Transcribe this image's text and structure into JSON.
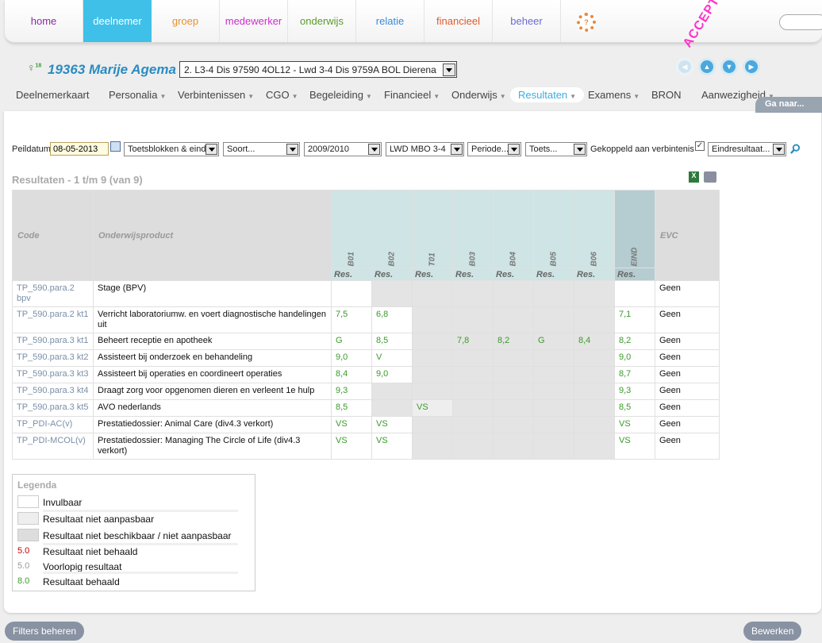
{
  "topnav": {
    "tabs": [
      {
        "label": "home",
        "color": "#8a2aa6"
      },
      {
        "label": "deelnemer",
        "color": "#ffffff"
      },
      {
        "label": "groep",
        "color": "#e8902a"
      },
      {
        "label": "medewerker",
        "color": "#cc2ecc"
      },
      {
        "label": "onderwijs",
        "color": "#5a9a2a"
      },
      {
        "label": "relatie",
        "color": "#3a8ad8"
      },
      {
        "label": "financieel",
        "color": "#e05a2a"
      },
      {
        "label": "beheer",
        "color": "#6a6ad8"
      }
    ],
    "active": "deelnemer",
    "stamp": "ACCEPT"
  },
  "student": {
    "name": "19363 Marije Agema",
    "age_badge": "18",
    "enrollment": "2. L3-4 Dis 97590 4OL12 - Lwd 3-4 Dis 9759A BOL Dierena"
  },
  "subnav": {
    "items": [
      {
        "label": "Deelnemerkaart",
        "caret": false
      },
      {
        "label": "Personalia",
        "caret": true
      },
      {
        "label": "Verbintenissen",
        "caret": true
      },
      {
        "label": "CGO",
        "caret": true
      },
      {
        "label": "Begeleiding",
        "caret": true
      },
      {
        "label": "Financieel",
        "caret": true
      },
      {
        "label": "Onderwijs",
        "caret": true
      },
      {
        "label": "Resultaten",
        "caret": true
      },
      {
        "label": "Examens",
        "caret": true
      },
      {
        "label": "BRON",
        "caret": false
      },
      {
        "label": "Aanwezigheid",
        "caret": true
      }
    ],
    "active": "Resultaten",
    "ga_naar": "Ga naar..."
  },
  "filters": {
    "peildatum_label": "Peildatum",
    "peildatum_value": "08-05-2013",
    "toetsblokken": "Toetsblokken & eind",
    "soort": "Soort...",
    "jaar": "2009/2010",
    "opleiding": "LWD MBO 3-4",
    "periode": "Periode...",
    "toets": "Toets...",
    "gekoppeld_label": "Gekoppeld aan verbintenis",
    "gekoppeld_checked": true,
    "eindresultaat": "Eindresultaat..."
  },
  "results": {
    "title": "Resultaten - 1 t/m 9 (van 9)",
    "headers": {
      "code": "Code",
      "product": "Onderwijsproduct",
      "columns": [
        "B01",
        "B02",
        "T01",
        "B03",
        "B04",
        "B05",
        "B06",
        "EIND"
      ],
      "sub": "Res.",
      "evc": "EVC"
    },
    "rows": [
      {
        "code": "TP_590.para.2 bpv",
        "product": "Stage (BPV)",
        "cells": [
          {
            "v": "",
            "s": "empty"
          },
          {
            "v": "",
            "s": "na"
          },
          {
            "v": "",
            "s": "na"
          },
          {
            "v": "",
            "s": "na"
          },
          {
            "v": "",
            "s": "na"
          },
          {
            "v": "",
            "s": "na"
          },
          {
            "v": "",
            "s": "na"
          },
          {
            "v": "",
            "s": "empty"
          }
        ],
        "evc": "Geen"
      },
      {
        "code": "TP_590.para.2 kt1",
        "product": "Verricht laboratoriumw. en voert diagnostische handelingen uit",
        "cells": [
          {
            "v": "7,5",
            "s": "empty"
          },
          {
            "v": "6,8",
            "s": "empty"
          },
          {
            "v": "",
            "s": "na"
          },
          {
            "v": "",
            "s": "na"
          },
          {
            "v": "",
            "s": "na"
          },
          {
            "v": "",
            "s": "na"
          },
          {
            "v": "",
            "s": "na"
          },
          {
            "v": "7,1",
            "s": "empty"
          }
        ],
        "evc": "Geen"
      },
      {
        "code": "TP_590.para.3 kt1",
        "product": "Beheert receptie en apotheek",
        "cells": [
          {
            "v": "G",
            "s": "empty"
          },
          {
            "v": "8,5",
            "s": "empty"
          },
          {
            "v": "",
            "s": "na"
          },
          {
            "v": "7,8",
            "s": "na"
          },
          {
            "v": "8,2",
            "s": "na"
          },
          {
            "v": "G",
            "s": "na"
          },
          {
            "v": "8,4",
            "s": "na"
          },
          {
            "v": "8,2",
            "s": "empty"
          }
        ],
        "evc": "Geen"
      },
      {
        "code": "TP_590.para.3 kt2",
        "product": "Assisteert bij onderzoek en behandeling",
        "cells": [
          {
            "v": "9,0",
            "s": "empty"
          },
          {
            "v": "V",
            "s": "empty"
          },
          {
            "v": "",
            "s": "na"
          },
          {
            "v": "",
            "s": "na"
          },
          {
            "v": "",
            "s": "na"
          },
          {
            "v": "",
            "s": "na"
          },
          {
            "v": "",
            "s": "na"
          },
          {
            "v": "9,0",
            "s": "empty"
          }
        ],
        "evc": "Geen"
      },
      {
        "code": "TP_590.para.3 kt3",
        "product": "Assisteert bij operaties en coordineert operaties",
        "cells": [
          {
            "v": "8,4",
            "s": "empty"
          },
          {
            "v": "9,0",
            "s": "empty"
          },
          {
            "v": "",
            "s": "na"
          },
          {
            "v": "",
            "s": "na"
          },
          {
            "v": "",
            "s": "na"
          },
          {
            "v": "",
            "s": "na"
          },
          {
            "v": "",
            "s": "na"
          },
          {
            "v": "8,7",
            "s": "empty"
          }
        ],
        "evc": "Geen"
      },
      {
        "code": "TP_590.para.3 kt4",
        "product": "Draagt zorg voor opgenomen dieren en verleent 1e hulp",
        "cells": [
          {
            "v": "9,3",
            "s": "empty"
          },
          {
            "v": "",
            "s": "na"
          },
          {
            "v": "",
            "s": "na"
          },
          {
            "v": "",
            "s": "na"
          },
          {
            "v": "",
            "s": "na"
          },
          {
            "v": "",
            "s": "na"
          },
          {
            "v": "",
            "s": "na"
          },
          {
            "v": "9,3",
            "s": "empty"
          }
        ],
        "evc": "Geen"
      },
      {
        "code": "TP_590.para.3 kt5",
        "product": "AVO nederlands",
        "cells": [
          {
            "v": "8,5",
            "s": "empty"
          },
          {
            "v": "",
            "s": "na"
          },
          {
            "v": "VS",
            "s": "light"
          },
          {
            "v": "",
            "s": "na"
          },
          {
            "v": "",
            "s": "na"
          },
          {
            "v": "",
            "s": "na"
          },
          {
            "v": "",
            "s": "na"
          },
          {
            "v": "8,5",
            "s": "empty"
          }
        ],
        "evc": "Geen"
      },
      {
        "code": "TP_PDI-AC(v)",
        "product": "Prestatiedossier: Animal Care (div4.3 verkort)",
        "cells": [
          {
            "v": "VS",
            "s": "empty"
          },
          {
            "v": "VS",
            "s": "empty"
          },
          {
            "v": "",
            "s": "na"
          },
          {
            "v": "",
            "s": "na"
          },
          {
            "v": "",
            "s": "na"
          },
          {
            "v": "",
            "s": "na"
          },
          {
            "v": "",
            "s": "na"
          },
          {
            "v": "VS",
            "s": "empty"
          }
        ],
        "evc": "Geen"
      },
      {
        "code": "TP_PDI-MCOL(v)",
        "product": "Prestatiedossier: Managing The Circle of Life (div4.3 verkort)",
        "cells": [
          {
            "v": "VS",
            "s": "empty"
          },
          {
            "v": "VS",
            "s": "empty"
          },
          {
            "v": "",
            "s": "na"
          },
          {
            "v": "",
            "s": "na"
          },
          {
            "v": "",
            "s": "na"
          },
          {
            "v": "",
            "s": "na"
          },
          {
            "v": "",
            "s": "na"
          },
          {
            "v": "VS",
            "s": "empty"
          }
        ],
        "evc": "Geen"
      }
    ]
  },
  "legend": {
    "title": "Legenda",
    "items": [
      {
        "label": "Invulbaar",
        "swatch": "#ffffff",
        "num": ""
      },
      {
        "label": "Resultaat niet aanpasbaar",
        "swatch": "#eeeeee",
        "num": ""
      },
      {
        "label": "Resultaat niet beschikbaar / niet aanpasbaar",
        "swatch": "#dddddd",
        "num": ""
      },
      {
        "label": "Resultaat niet behaald",
        "swatch": "",
        "num": "5.0",
        "numColor": "#c00000"
      },
      {
        "label": "Voorlopig resultaat",
        "swatch": "",
        "num": "5.0",
        "numColor": "#999999"
      },
      {
        "label": "Resultaat behaald",
        "swatch": "",
        "num": "8.0",
        "numColor": "#3a9a2a"
      }
    ]
  },
  "footer": {
    "filters_button": "Filters beheren",
    "edit_button": "Bewerken"
  }
}
